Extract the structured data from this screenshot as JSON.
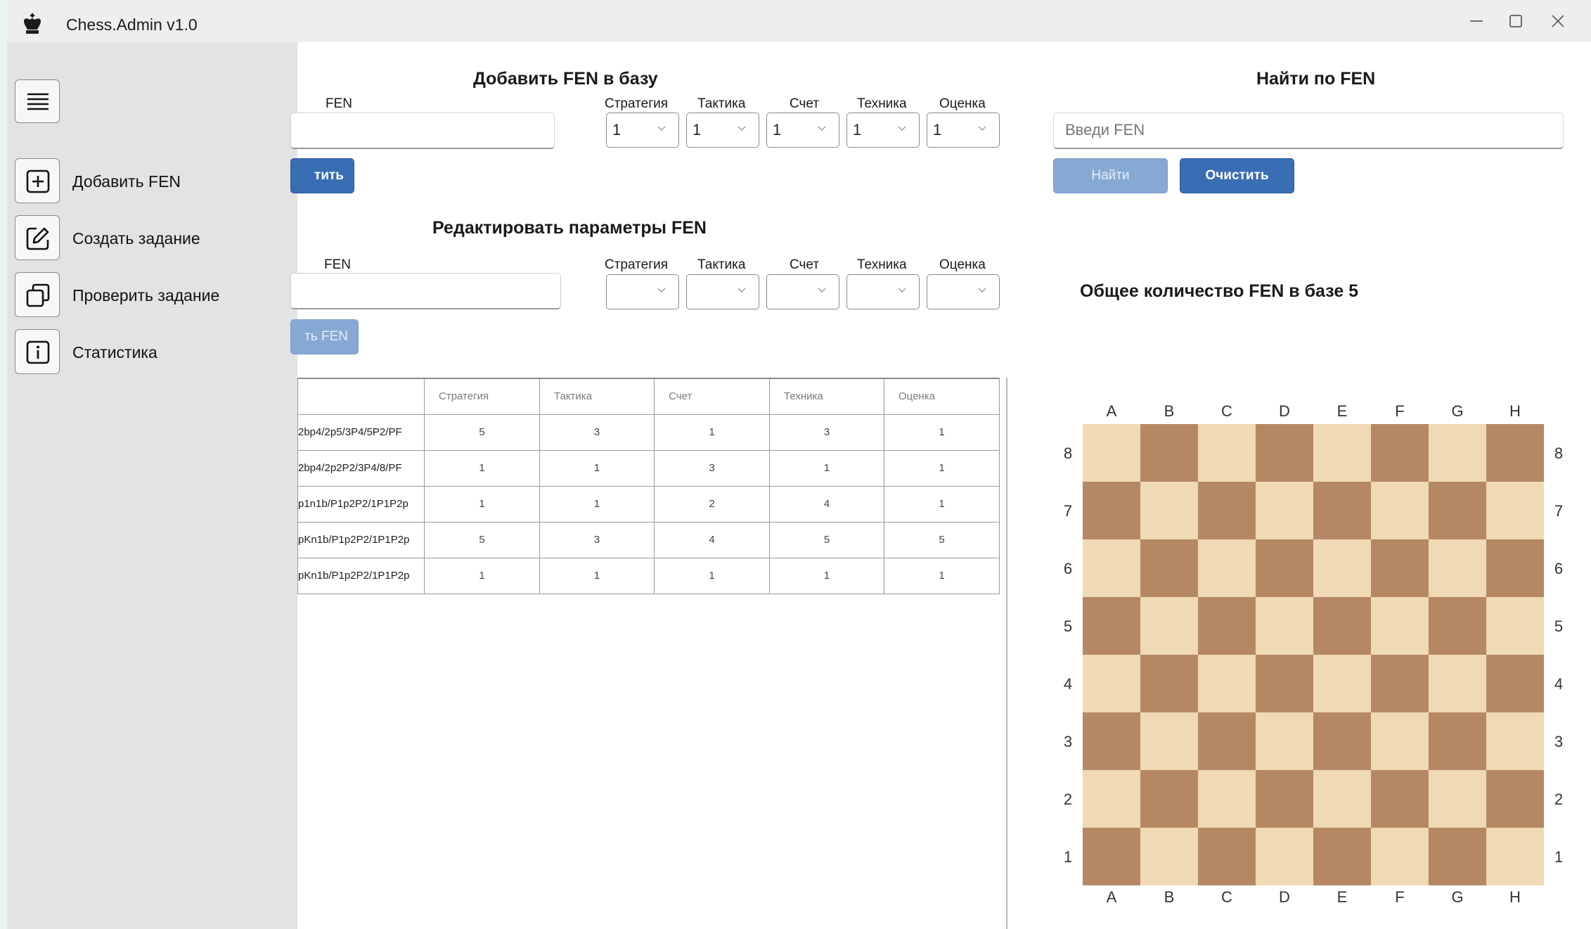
{
  "window": {
    "title": "Chess.Admin v1.0",
    "icon": "chess-king-icon"
  },
  "sidebar": {
    "menu_icon": "hamburger-icon",
    "items": [
      {
        "label": "Добавить FEN",
        "icon": "plus-square-icon"
      },
      {
        "label": "Создать задание",
        "icon": "edit-icon"
      },
      {
        "label": "Проверить задание",
        "icon": "copy-icon"
      },
      {
        "label": "Статистика",
        "icon": "info-icon"
      }
    ]
  },
  "add_section": {
    "title": "Добавить FEN в базу",
    "fen_label": "FEN",
    "fen_value": "",
    "params": [
      {
        "label": "Стратегия",
        "value": "1"
      },
      {
        "label": "Тактика",
        "value": "1"
      },
      {
        "label": "Счет",
        "value": "1"
      },
      {
        "label": "Техника",
        "value": "1"
      },
      {
        "label": "Оценка",
        "value": "1"
      }
    ],
    "button_label": "тить"
  },
  "edit_section": {
    "title": "Редактировать параметры FEN",
    "fen_label": "FEN",
    "fen_value": "",
    "params": [
      {
        "label": "Стратегия",
        "value": ""
      },
      {
        "label": "Тактика",
        "value": ""
      },
      {
        "label": "Счет",
        "value": ""
      },
      {
        "label": "Техника",
        "value": ""
      },
      {
        "label": "Оценка",
        "value": ""
      }
    ],
    "button_label": "ть FEN"
  },
  "search_section": {
    "title": "Найти по FEN",
    "placeholder": "Введи FEN",
    "find_label": "Найти",
    "clear_label": "Очистить"
  },
  "total": {
    "label": "Общее количество FEN в базе 5"
  },
  "table": {
    "columns": [
      "",
      "Стратегия",
      "Тактика",
      "Счет",
      "Техника",
      "Оценка"
    ],
    "rows": [
      [
        "2bp4/2p5/3P4/5P2/PF",
        "5",
        "3",
        "1",
        "3",
        "1"
      ],
      [
        "2bp4/2p2P2/3P4/8/PF",
        "1",
        "1",
        "3",
        "1",
        "1"
      ],
      [
        "p1n1b/P1p2P2/1P1P2p",
        "1",
        "1",
        "2",
        "4",
        "1"
      ],
      [
        "pKn1b/P1p2P2/1P1P2p",
        "5",
        "3",
        "4",
        "5",
        "5"
      ],
      [
        "pKn1b/P1p2P2/1P1P2p",
        "1",
        "1",
        "1",
        "1",
        "1"
      ]
    ]
  },
  "board": {
    "files": [
      "A",
      "B",
      "C",
      "D",
      "E",
      "F",
      "G",
      "H"
    ],
    "ranks": [
      "8",
      "7",
      "6",
      "5",
      "4",
      "3",
      "2",
      "1"
    ],
    "light_color": "#f0d9b5",
    "dark_color": "#b58863"
  }
}
